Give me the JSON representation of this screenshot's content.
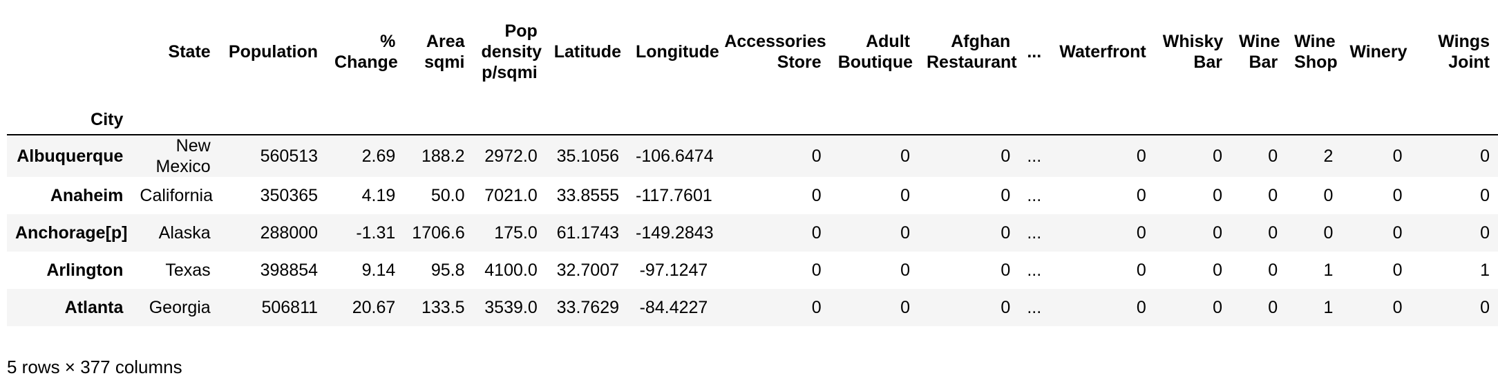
{
  "table": {
    "index_name": "City",
    "columns": [
      {
        "label_lines": [
          "State"
        ]
      },
      {
        "label_lines": [
          "Population"
        ]
      },
      {
        "label_lines": [
          "%",
          "Change"
        ]
      },
      {
        "label_lines": [
          "Area",
          "sqmi"
        ]
      },
      {
        "label_lines": [
          "Pop",
          "density",
          "p/sqmi"
        ]
      },
      {
        "label_lines": [
          "Latitude"
        ]
      },
      {
        "label_lines": [
          "Longitude"
        ]
      },
      {
        "label_lines": [
          "Accessories",
          "Store"
        ]
      },
      {
        "label_lines": [
          "Adult",
          "Boutique"
        ]
      },
      {
        "label_lines": [
          "Afghan",
          "Restaurant"
        ]
      },
      {
        "label_lines": [
          "..."
        ]
      },
      {
        "label_lines": [
          "Waterfront"
        ]
      },
      {
        "label_lines": [
          "Whisky",
          "Bar"
        ]
      },
      {
        "label_lines": [
          "Wine",
          "Bar"
        ]
      },
      {
        "label_lines": [
          "Wine",
          "Shop"
        ]
      },
      {
        "label_lines": [
          "Winery"
        ]
      },
      {
        "label_lines": [
          "Wings",
          "Joint"
        ]
      }
    ],
    "rows": [
      {
        "city": "Albuquerque",
        "state_lines": [
          "New",
          "Mexico"
        ],
        "values": [
          "560513",
          "2.69",
          "188.2",
          "2972.0",
          "35.1056",
          "-106.6474",
          "0",
          "0",
          "0",
          "...",
          "0",
          "0",
          "0",
          "2",
          "0",
          "0"
        ]
      },
      {
        "city": "Anaheim",
        "state_lines": [
          "California"
        ],
        "values": [
          "350365",
          "4.19",
          "50.0",
          "7021.0",
          "33.8555",
          "-117.7601",
          "0",
          "0",
          "0",
          "...",
          "0",
          "0",
          "0",
          "0",
          "0",
          "0"
        ]
      },
      {
        "city": "Anchorage[p]",
        "state_lines": [
          "Alaska"
        ],
        "values": [
          "288000",
          "-1.31",
          "1706.6",
          "175.0",
          "61.1743",
          "-149.2843",
          "0",
          "0",
          "0",
          "...",
          "0",
          "0",
          "0",
          "0",
          "0",
          "0"
        ]
      },
      {
        "city": "Arlington",
        "state_lines": [
          "Texas"
        ],
        "values": [
          "398854",
          "9.14",
          "95.8",
          "4100.0",
          "32.7007",
          "-97.1247",
          "0",
          "0",
          "0",
          "...",
          "0",
          "0",
          "0",
          "1",
          "0",
          "1"
        ]
      },
      {
        "city": "Atlanta",
        "state_lines": [
          "Georgia"
        ],
        "values": [
          "506811",
          "20.67",
          "133.5",
          "3539.0",
          "33.7629",
          "-84.4227",
          "0",
          "0",
          "0",
          "...",
          "0",
          "0",
          "0",
          "1",
          "0",
          "0"
        ]
      }
    ]
  },
  "footer": "5 rows × 377 columns"
}
